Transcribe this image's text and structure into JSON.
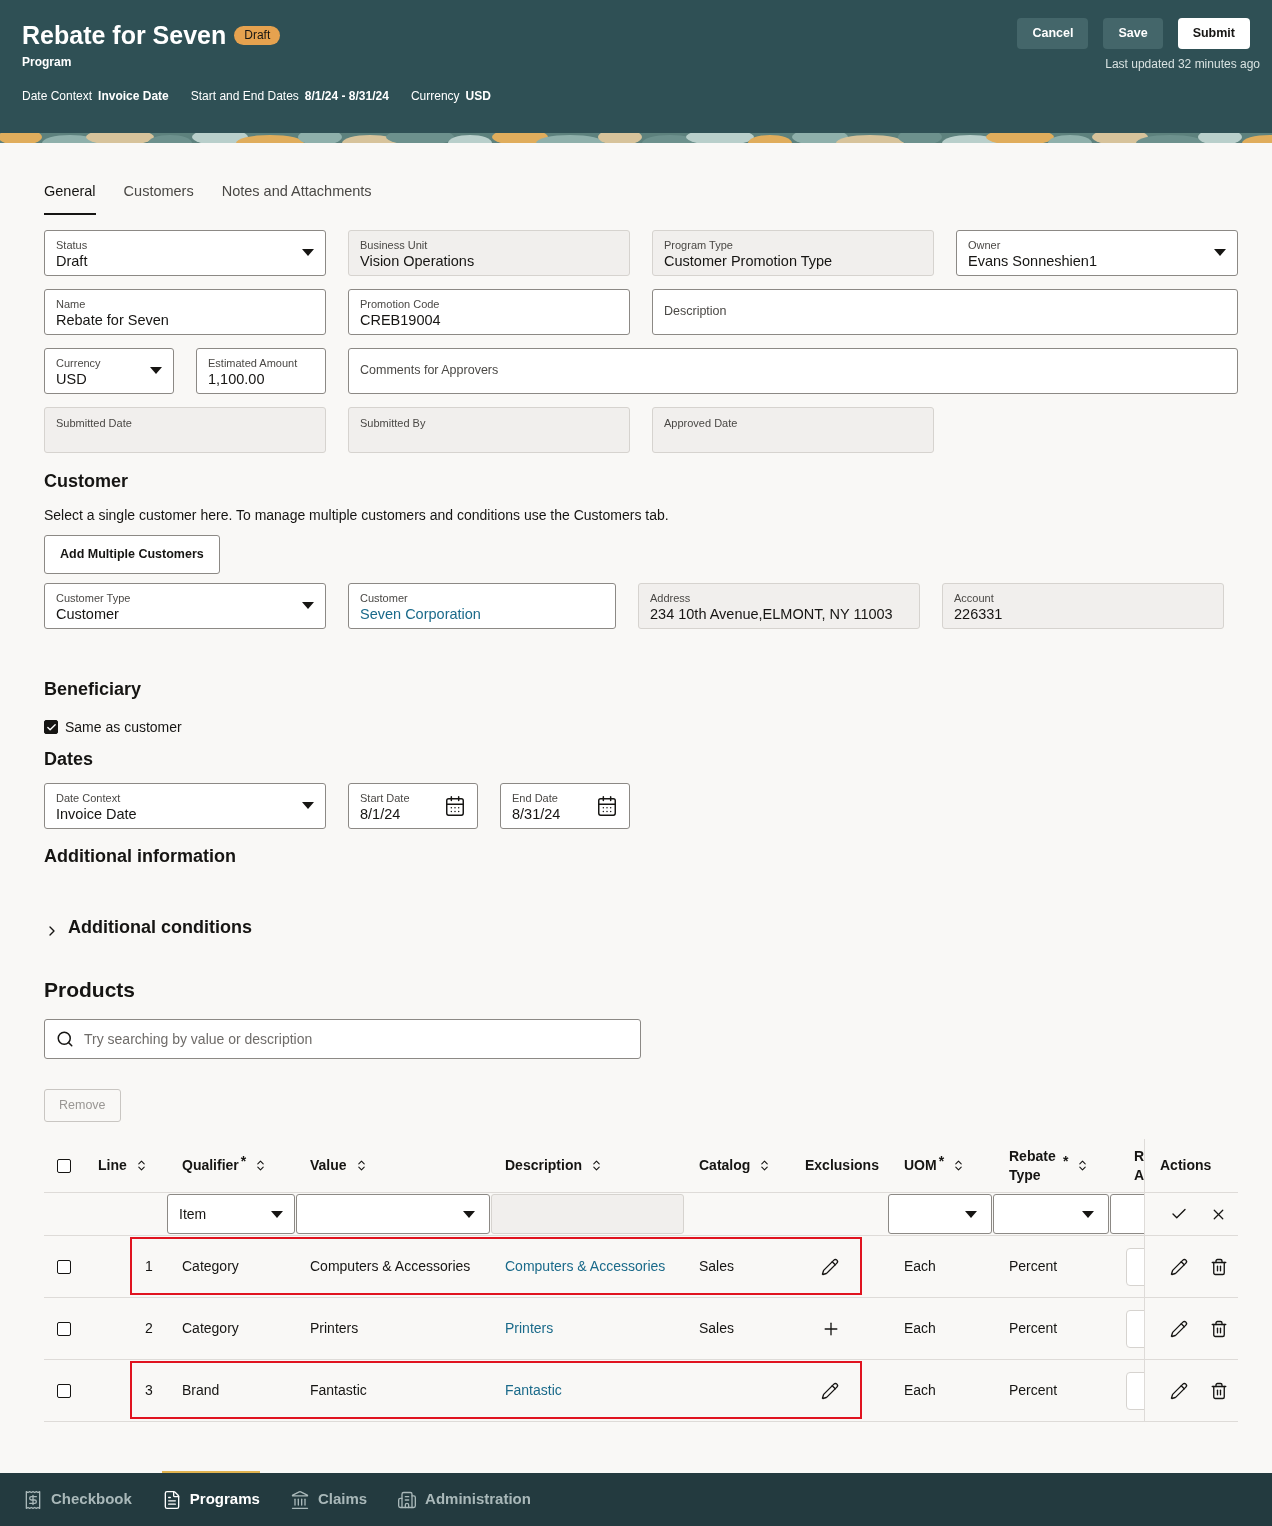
{
  "header": {
    "title": "Rebate for Seven",
    "badge": "Draft",
    "subtitle": "Program",
    "buttons": [
      {
        "label": "Cancel",
        "kind": "secondary"
      },
      {
        "label": "Save",
        "kind": "secondary"
      },
      {
        "label": "Submit",
        "kind": "primary"
      }
    ],
    "updated": "Last updated 32 minutes ago",
    "facts": [
      {
        "label": "Date Context",
        "value": "Invoice Date"
      },
      {
        "label": "Start and End Dates",
        "value": "8/1/24 - 8/31/24"
      },
      {
        "label": "Currency",
        "value": "USD"
      }
    ]
  },
  "tabs": [
    {
      "label": "General",
      "selected": true
    },
    {
      "label": "Customers",
      "selected": false
    },
    {
      "label": "Notes and Attachments",
      "selected": false
    }
  ],
  "general_fields": [
    {
      "label": "Status",
      "value": "Draft",
      "kind": "select"
    },
    {
      "label": "Business Unit",
      "value": "Vision Operations",
      "kind": "readonly"
    },
    {
      "label": "Program Type",
      "value": "Customer Promotion Type",
      "kind": "readonly"
    },
    {
      "label": "Owner",
      "value": "Evans Sonneshien1",
      "kind": "select"
    },
    {
      "label": "Name",
      "value": "Rebate for Seven",
      "kind": "text"
    },
    {
      "label": "Promotion Code",
      "value": "CREB19004",
      "kind": "text"
    },
    {
      "label": "Description",
      "kind": "text"
    },
    {
      "label": "Currency",
      "value": "USD",
      "kind": "select"
    },
    {
      "label": "Estimated Amount",
      "value": "1,100.00",
      "kind": "text"
    },
    {
      "label": "Comments for Approvers",
      "kind": "text"
    },
    {
      "label": "Submitted Date",
      "kind": "readonly"
    },
    {
      "label": "Submitted By",
      "kind": "readonly"
    },
    {
      "label": "Approved Date",
      "kind": "readonly"
    }
  ],
  "customer": {
    "heading": "Customer",
    "hint": "Select a single customer here. To manage multiple customers and conditions use the Customers tab.",
    "button": "Add Multiple Customers",
    "fields": [
      {
        "label": "Customer Type",
        "value": "Customer",
        "kind": "select"
      },
      {
        "label": "Customer",
        "value": "Seven Corporation",
        "kind": "link"
      },
      {
        "label": "Address",
        "value": "234 10th Avenue,ELMONT, NY 11003",
        "kind": "readonly"
      },
      {
        "label": "Account",
        "value": "226331",
        "kind": "readonly"
      }
    ]
  },
  "beneficiary": {
    "heading": "Beneficiary",
    "checkbox": {
      "label": "Same as customer",
      "checked": true
    }
  },
  "dates": {
    "heading": "Dates",
    "fields": [
      {
        "label": "Date Context",
        "value": "Invoice Date",
        "kind": "select"
      },
      {
        "label": "Start Date",
        "value": "8/1/24",
        "kind": "date"
      },
      {
        "label": "End Date",
        "value": "8/31/24",
        "kind": "date"
      }
    ]
  },
  "additional_information": {
    "heading": "Additional information"
  },
  "additional_conditions": {
    "heading": "Additional conditions",
    "expanded": false
  },
  "products": {
    "heading": "Products",
    "search": {
      "placeholder": "Try searching by value or description"
    },
    "remove_button": {
      "label": "Remove",
      "disabled": true
    },
    "table": {
      "select_all": {
        "checked": false
      },
      "columns": [
        {
          "label": "Line",
          "sortable": true
        },
        {
          "label": "Qualifier",
          "sortable": true,
          "required_mark": "*"
        },
        {
          "label": "Value",
          "sortable": true
        },
        {
          "label": "Description",
          "sortable": true
        },
        {
          "label": "Catalog",
          "sortable": true
        },
        {
          "label": "Exclusions",
          "sortable": false
        },
        {
          "label": "UOM",
          "sortable": true,
          "required_mark": "*"
        },
        {
          "label": "Rebate Type",
          "sortable": true,
          "required_mark": "*"
        },
        {
          "label": "R A",
          "sortable": false
        },
        {
          "label": "Actions",
          "sortable": false
        }
      ],
      "filter": {
        "qualifier": "Item"
      },
      "rows": [
        {
          "checked": false,
          "line": "1",
          "qualifier": "Category",
          "value": "Computers & Accessories",
          "description": "Computers & Accessories",
          "catalog": "Sales",
          "exclusion": {
            "kind": "edit"
          },
          "uom": "Each",
          "rebate_type": "Percent",
          "highlighted": true
        },
        {
          "checked": false,
          "line": "2",
          "qualifier": "Category",
          "value": "Printers",
          "description": "Printers",
          "catalog": "Sales",
          "exclusion": {
            "kind": "add"
          },
          "uom": "Each",
          "rebate_type": "Percent",
          "highlighted": false
        },
        {
          "checked": false,
          "line": "3",
          "qualifier": "Brand",
          "value": "Fantastic",
          "description": "Fantastic",
          "exclusion": {
            "kind": "edit"
          },
          "uom": "Each",
          "rebate_type": "Percent",
          "highlighted": true
        }
      ]
    }
  },
  "bottom_nav": [
    {
      "label": "Checkbook",
      "selected": false
    },
    {
      "label": "Programs",
      "selected": true
    },
    {
      "label": "Claims",
      "selected": false
    },
    {
      "label": "Administration",
      "selected": false
    }
  ]
}
